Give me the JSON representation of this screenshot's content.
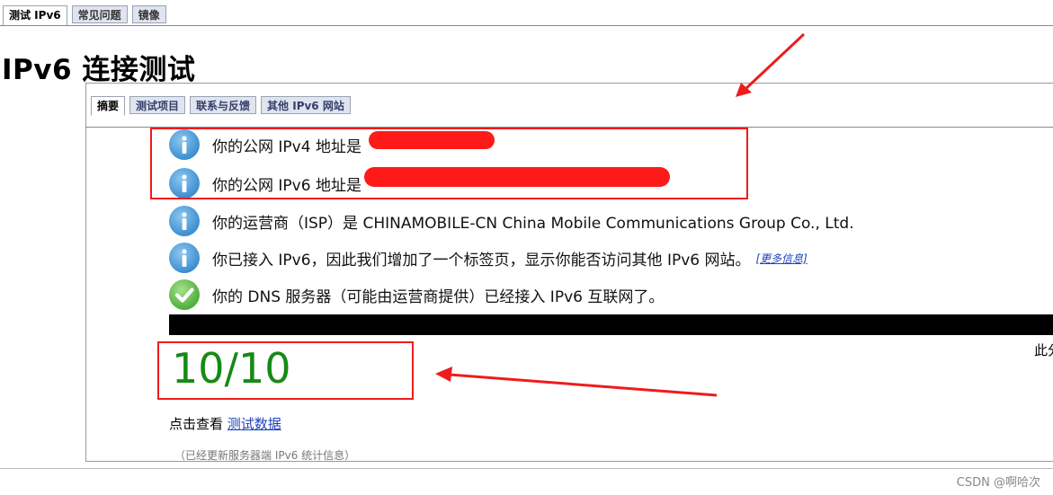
{
  "top_tabs": [
    "测试 IPv6",
    "常见问题",
    "镜像"
  ],
  "page_title": "IPv6 连接测试",
  "inner_tabs": [
    "摘要",
    "测试项目",
    "联系与反馈",
    "其他 IPv6 网站"
  ],
  "rows": [
    {
      "text": "你的公网 IPv4 地址是",
      "icon": "info-icon"
    },
    {
      "text": "你的公网 IPv6 地址是",
      "icon": "info-icon"
    },
    {
      "text": "你的运营商（ISP）是 CHINAMOBILE-CN China Mobile Communications Group Co., Ltd.",
      "icon": "info-icon"
    },
    {
      "text": "你已接入 IPv6，因此我们增加了一个标签页，显示你能否访问其他 IPv6 网站。",
      "link": "[更多信息]",
      "icon": "info-icon"
    },
    {
      "text": "你的 DNS 服务器（可能由运营商提供）已经接入 IPv6 互联网了。",
      "icon": "check-icon"
    }
  ],
  "edge_text": "此分",
  "score": "10/10",
  "click_view": {
    "prefix": "点击查看 ",
    "link": "测试数据"
  },
  "stats_note": "（已经更新服务器端 IPv6 统计信息）",
  "watermark": "CSDN @啊哈次",
  "colors": {
    "score": "#168a16",
    "annotation": "#ee1c1c",
    "link": "#1d3fbf"
  }
}
